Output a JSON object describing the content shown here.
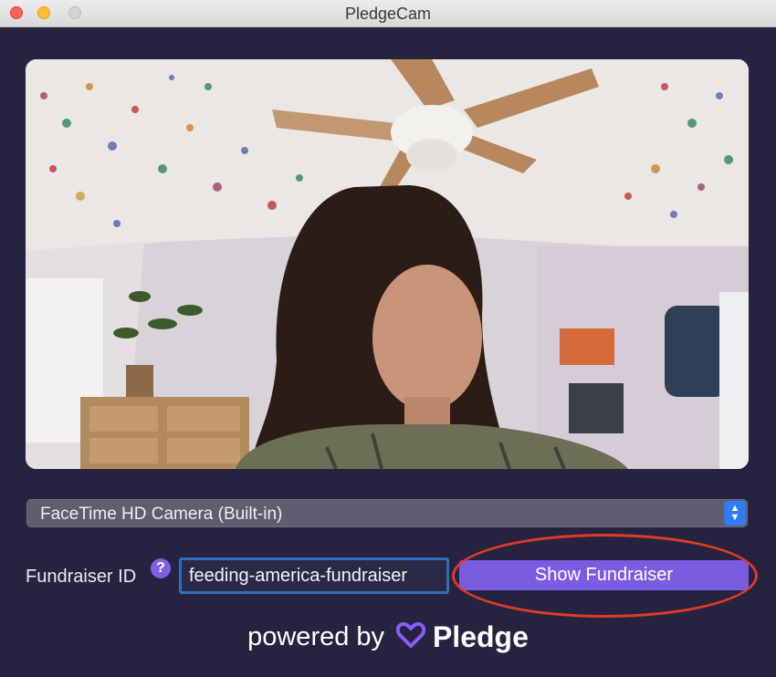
{
  "window": {
    "title": "PledgeCam"
  },
  "camera": {
    "selected": "FaceTime HD Camera (Built-in)"
  },
  "fundraiser": {
    "label": "Fundraiser ID",
    "help": "?",
    "value": "feeding-america-fundraiser",
    "button_label": "Show Fundraiser"
  },
  "footer": {
    "powered_by": "powered by",
    "brand": "Pledge"
  },
  "colors": {
    "background": "#262341",
    "accent": "#7b5ce0",
    "select_arrows": "#2f7bf6",
    "annotation": "#e23a26"
  }
}
